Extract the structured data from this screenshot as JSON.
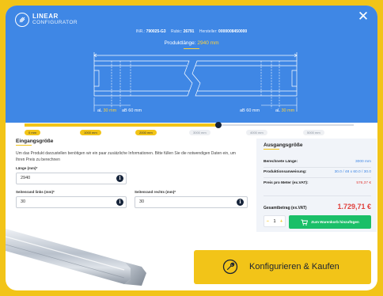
{
  "app": {
    "logo_line1": "LINEAR",
    "logo_line2": "CONFIGURATOR",
    "close_glyph": "✕"
  },
  "meta": {
    "inr_label": "INR.:",
    "inr_value": "790025-G3",
    "rubic_label": "Rubic:",
    "rubic_value": "26791",
    "hersteller_label": "Hersteller:",
    "hersteller_value": "0000008450000"
  },
  "product_length": {
    "label": "Produktlänge:",
    "value": "2940 mm"
  },
  "diagram": {
    "al_left": "aL",
    "al_left_val": "30 mm",
    "ab_left": "aB 60 mm",
    "ab_right": "aB 60 mm",
    "al_right": "aL",
    "al_right_val": "30 mm"
  },
  "slider": {
    "ticks": [
      "0 mm",
      "1000 mm",
      "2000 mm",
      "3000 mm",
      "4000 mm",
      "5000 mm"
    ],
    "value_fraction": 0.588
  },
  "eingang": {
    "title": "Eingangsgröße",
    "description": "Um das Produkt darzustellen benötigen wir ein paar zusätzliche Informationen. Bitte füllen Sie die notwendigen Daten ein, um Ihren Preis zu berechnen",
    "length_label": "Länge (mm)*",
    "length_value": "2940",
    "left_label": "Seitenrand links (mm)*",
    "left_value": "30",
    "right_label": "Seitenrand rechts (mm)*",
    "right_value": "30",
    "info_glyph": "i"
  },
  "ausgang": {
    "title": "Ausgangsgröße",
    "rows": [
      {
        "k": "Berechnete Länge:",
        "v": "3000 mm"
      },
      {
        "k": "Produktionsanweisung:",
        "v": "30.0 / 48 x 60.0 / 30.0"
      },
      {
        "k": "Preis pro Meter (ex.VAT):",
        "v": "576,37 €"
      }
    ],
    "total_label": "Gesamtbetrag (ex.VAT)",
    "total_value": "1.729,71 €",
    "qty_minus": "−",
    "qty_value": "1",
    "qty_plus": "+",
    "cart_label": "Zum Warenkorb hinzufügen"
  },
  "cta": {
    "label": "Konfigurieren & Kaufen"
  },
  "colors": {
    "brand_yellow": "#f2c418",
    "hero_blue": "#3f87e5",
    "cart_green": "#1bbf68",
    "price_red": "#e0403c"
  }
}
